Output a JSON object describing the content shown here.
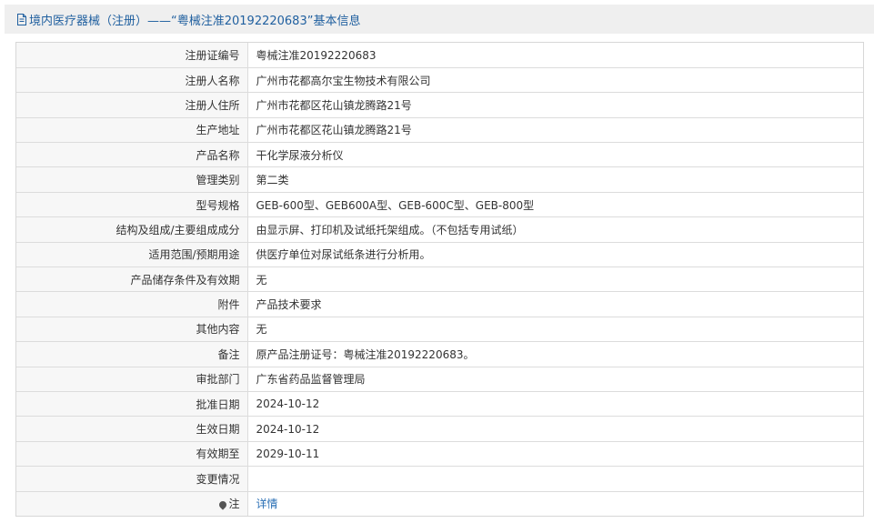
{
  "header": {
    "title": "境内医疗器械（注册）——“粤械注准20192220683”基本信息",
    "icon": "document-icon"
  },
  "rows": [
    {
      "label": "注册证编号",
      "value": "粤械注准20192220683"
    },
    {
      "label": "注册人名称",
      "value": "广州市花都高尔宝生物技术有限公司"
    },
    {
      "label": "注册人住所",
      "value": "广州市花都区花山镇龙腾路21号"
    },
    {
      "label": "生产地址",
      "value": "广州市花都区花山镇龙腾路21号"
    },
    {
      "label": "产品名称",
      "value": "干化学尿液分析仪"
    },
    {
      "label": "管理类别",
      "value": "第二类"
    },
    {
      "label": "型号规格",
      "value": "GEB-600型、GEB600A型、GEB-600C型、GEB-800型"
    },
    {
      "label": "结构及组成/主要组成成分",
      "value": "由显示屏、打印机及试纸托架组成。（不包括专用试纸）"
    },
    {
      "label": "适用范围/预期用途",
      "value": "供医疗单位对尿试纸条进行分析用。"
    },
    {
      "label": "产品储存条件及有效期",
      "value": "无"
    },
    {
      "label": "附件",
      "value": "产品技术要求"
    },
    {
      "label": "其他内容",
      "value": "无"
    },
    {
      "label": "备注",
      "value": "原产品注册证号：粤械注准20192220683。"
    },
    {
      "label": "审批部门",
      "value": "广东省药品监督管理局"
    },
    {
      "label": "批准日期",
      "value": "2024-10-12"
    },
    {
      "label": "生效日期",
      "value": "2024-10-12"
    },
    {
      "label": "有效期至",
      "value": "2029-10-11"
    },
    {
      "label": "变更情况",
      "value": ""
    }
  ],
  "note": {
    "label": "注",
    "icon": "pin-icon",
    "link_text": "详情"
  }
}
